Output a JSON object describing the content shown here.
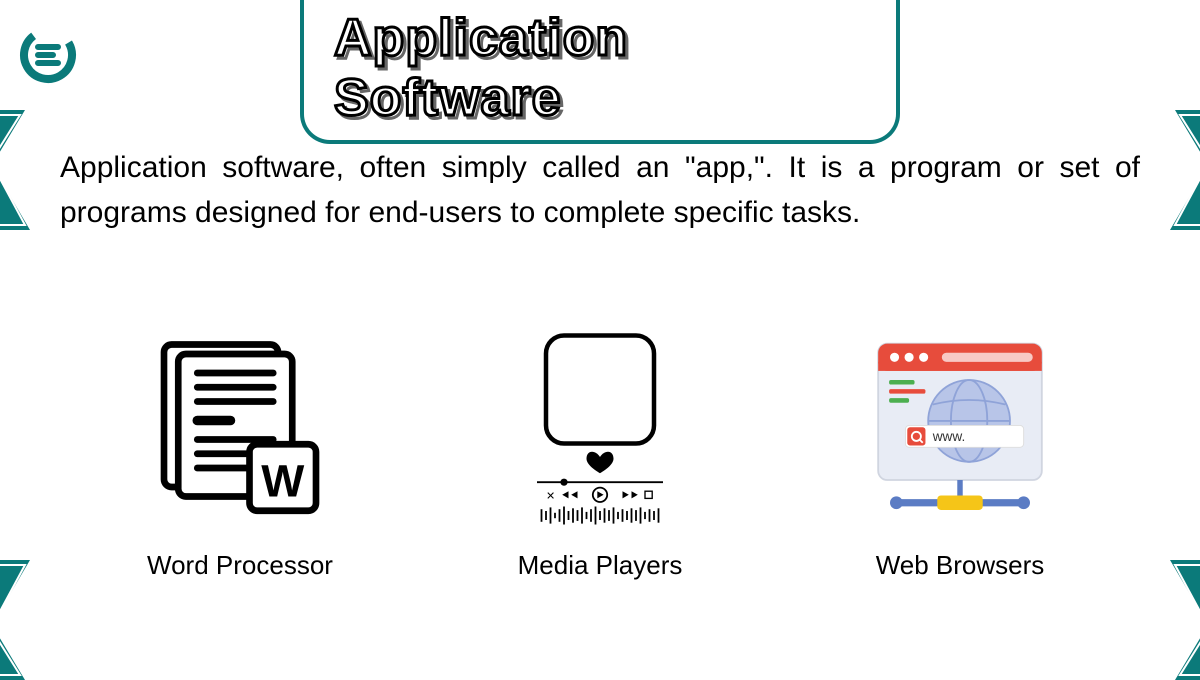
{
  "title": "Application Software",
  "description": "Application software, often simply called an \"app,\". It is a program or set of programs designed for end-users to complete specific tasks.",
  "items": [
    {
      "label": "Word Processor"
    },
    {
      "label": "Media Players"
    },
    {
      "label": "Web Browsers"
    }
  ],
  "browser_url_text": "www.",
  "colors": {
    "teal": "#0b7a7a",
    "red": "#e74c3c",
    "blue": "#5b7cc4",
    "yellow": "#f5c518"
  }
}
